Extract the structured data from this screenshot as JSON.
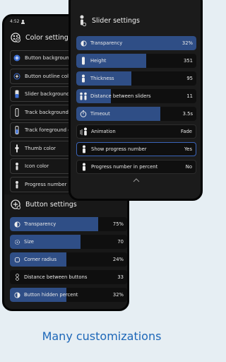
{
  "status_time": "4:52",
  "color_settings": {
    "title": "Color settings",
    "items": [
      {
        "label": "Button background color",
        "icon": "circle-plus-filled-icon"
      },
      {
        "label": "Button outline color",
        "icon": "circle-plus-outline-icon"
      },
      {
        "label": "Slider background color",
        "icon": "slider-icon"
      },
      {
        "label": "Track background color",
        "icon": "track-icon"
      },
      {
        "label": "Track foreground color",
        "icon": "track-fg-icon"
      },
      {
        "label": "Thumb color",
        "icon": "thumb-icon"
      },
      {
        "label": "Icon color",
        "icon": "icon-color-icon"
      },
      {
        "label": "Progress number color",
        "icon": "number-icon"
      }
    ]
  },
  "button_settings": {
    "title": "Button settings",
    "rows": [
      {
        "label": "Transparency",
        "value": "75%",
        "fill": 0.75
      },
      {
        "label": "Size",
        "value": "70",
        "fill": 0.6
      },
      {
        "label": "Corner radius",
        "value": "24%",
        "fill": 0.48
      },
      {
        "label": "Distance between buttons",
        "value": "33",
        "fill": 0.0
      },
      {
        "label": "Button hidden percent",
        "value": "32%",
        "fill": 0.48
      }
    ]
  },
  "slider_settings": {
    "title": "Slider settings",
    "rows": [
      {
        "label": "Transparency",
        "value": "32%",
        "fill": 1.0,
        "type": "slider"
      },
      {
        "label": "Height",
        "value": "351",
        "fill": 0.58,
        "type": "slider"
      },
      {
        "label": "Thickness",
        "value": "95",
        "fill": 0.46,
        "type": "slider"
      },
      {
        "label": "Distance between sliders",
        "value": "11",
        "fill": 0.29,
        "type": "slider"
      },
      {
        "label": "Timeout",
        "value": "3.5s",
        "fill": 0.7,
        "type": "slider"
      },
      {
        "label": "Animation",
        "value": "Fade",
        "type": "toggle"
      },
      {
        "label": "Show progress number",
        "value": "Yes",
        "type": "toggle",
        "highlight": true
      },
      {
        "label": "Progress number in percent",
        "value": "No",
        "type": "toggle"
      }
    ]
  },
  "caption": "Many customizations",
  "colors": {
    "accent_fill": "#2f4e86",
    "highlight_border": "#3b64b8",
    "caption": "#1d67b8"
  }
}
